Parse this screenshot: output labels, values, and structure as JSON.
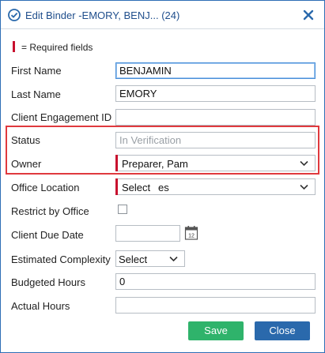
{
  "dialog": {
    "title": "Edit Binder -EMORY, BENJ... (24)",
    "icons": {
      "title": "check-circle-icon",
      "close": "close-x-icon"
    }
  },
  "required_note": "= Required fields",
  "fields": {
    "first_name": {
      "label": "First Name",
      "value": "BENJAMIN"
    },
    "last_name": {
      "label": "Last Name",
      "value": "EMORY"
    },
    "client_engagement_id": {
      "label": "Client Engagement ID",
      "value": ""
    },
    "status": {
      "label": "Status",
      "value": "In Verification"
    },
    "owner": {
      "label": "Owner",
      "value": "Preparer, Pam"
    },
    "office_location": {
      "label": "Office Location",
      "value": "Select",
      "value_suffix": "es"
    },
    "restrict_by_office": {
      "label": "Restrict by Office",
      "checked": false
    },
    "client_due_date": {
      "label": "Client Due Date",
      "value": ""
    },
    "estimated_complexity": {
      "label": "Estimated Complexity",
      "value": "Select"
    },
    "budgeted_hours": {
      "label": "Budgeted Hours",
      "value": "0"
    },
    "actual_hours": {
      "label": "Actual Hours",
      "value": ""
    }
  },
  "buttons": {
    "save": "Save",
    "close": "Close"
  },
  "colors": {
    "accent_blue": "#2a69ac",
    "save_green": "#2fb36b",
    "required_red": "#c8102e",
    "highlight_red": "#e0393e"
  }
}
